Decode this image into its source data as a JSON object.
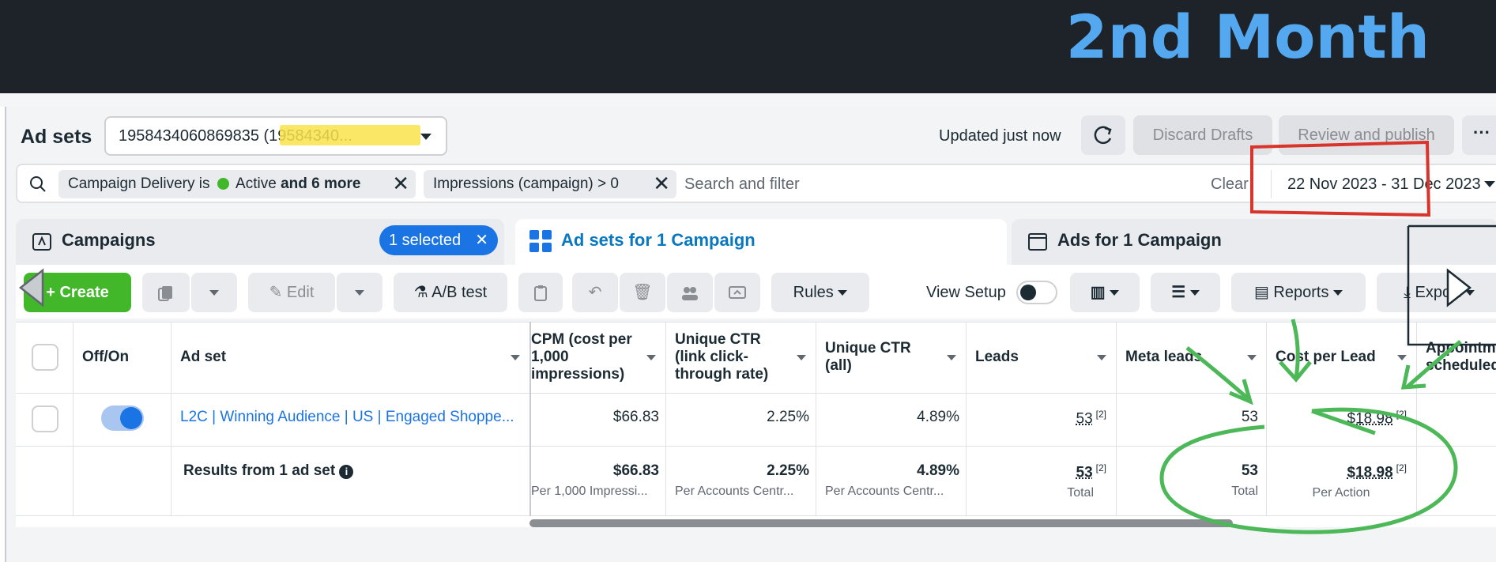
{
  "banner": {
    "title": "2nd Month"
  },
  "header": {
    "title": "Ad sets",
    "account": "1958434060869835 (19584340...",
    "updated": "Updated just now",
    "discard_drafts": "Discard Drafts",
    "review_publish": "Review and publish",
    "more": "···"
  },
  "filters": {
    "chip1_prefix": "Campaign Delivery is",
    "chip1_status": "Active",
    "chip1_more": "and 6 more",
    "chip2": "Impressions (campaign) > 0",
    "search_placeholder": "Search and filter",
    "clear": "Clear",
    "date_range": "22 Nov 2023 - 31 Dec 2023"
  },
  "tabs": {
    "campaigns": "Campaigns",
    "selected": "1 selected",
    "adsets": "Ad sets for 1 Campaign",
    "ads": "Ads for 1 Campaign"
  },
  "toolbar": {
    "create": "Create",
    "edit": "Edit",
    "ab_test": "A/B test",
    "rules": "Rules",
    "view_setup": "View Setup",
    "reports": "Reports",
    "export": "Export"
  },
  "table": {
    "headers": {
      "off_on": "Off/On",
      "ad_set": "Ad set",
      "cpm": "CPM (cost per 1,000 impressions)",
      "unique_ctr_link": "Unique CTR (link click-through rate)",
      "unique_ctr_all": "Unique CTR (all)",
      "leads": "Leads",
      "meta_leads": "Meta leads",
      "cost_per_lead": "Cost per Lead",
      "appointments": "Appointm scheduled"
    },
    "row": {
      "name": "L2C | Winning Audience | US | Engaged Shoppe...",
      "cpm": "$66.83",
      "unique_ctr_link": "2.25%",
      "unique_ctr_all": "4.89%",
      "leads": "53",
      "leads_note": "[2]",
      "meta_leads": "53",
      "cost_per_lead": "$18.98",
      "cost_note": "[2]"
    },
    "summary": {
      "label": "Results from 1 ad set",
      "cpm": "$66.83",
      "cpm_sub": "Per 1,000 Impressi...",
      "unique_ctr_link": "2.25%",
      "unique_ctr_link_sub": "Per Accounts Centr...",
      "unique_ctr_all": "4.89%",
      "unique_ctr_all_sub": "Per Accounts Centr...",
      "leads": "53",
      "leads_note": "[2]",
      "leads_sub": "Total",
      "meta_leads": "53",
      "meta_leads_sub": "Total",
      "cost_per_lead": "$18.98",
      "cost_note": "[2]",
      "cost_sub": "Per Action"
    }
  },
  "colors": {
    "accent": "#1b74e4",
    "create_green": "#42b72a",
    "banner_text": "#53a8f0",
    "annotation_green": "#4cb857",
    "annotation_red": "#d9342b"
  }
}
